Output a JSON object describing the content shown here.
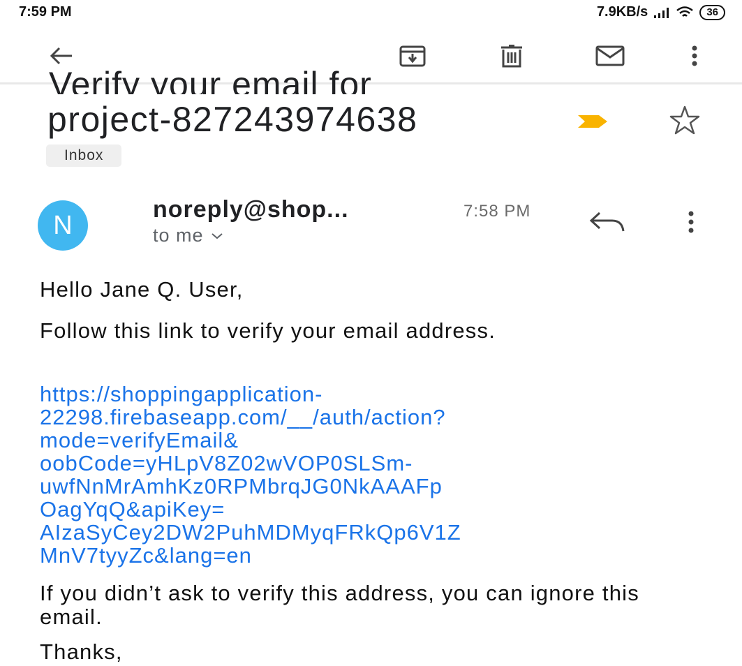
{
  "status_bar": {
    "time": "7:59 PM",
    "network_speed": "7.9KB/s",
    "battery": "36",
    "icons": [
      "signal-icon",
      "wifi-icon",
      "battery-icon"
    ]
  },
  "toolbar": {
    "icons": [
      "back-arrow-icon",
      "archive-icon",
      "delete-icon",
      "mark-unread-icon",
      "more-vert-icon"
    ]
  },
  "email": {
    "subject_line1": "Verify your email for",
    "subject_line2": "project-827243974638",
    "label": "Inbox",
    "sender_initial": "N",
    "sender_name": "noreply@shop...",
    "time": "7:58 PM",
    "recipient": "to me",
    "greeting": "Hello Jane Q. User,",
    "instruction": "Follow this link to verify your email address.",
    "link_lines": [
      "https://shoppingapplication-",
      "22298.firebaseapp.com/__/auth/action?",
      "mode=verifyEmail&",
      "oobCode=yHLpV8Z02wVOP0SLSm-",
      "uwfNnMrAmhKz0RPMbrqJG0NkAAAFp",
      "OagYqQ&apiKey=",
      "AIzaSyCey2DW2PuhMDMyqFRkQp6V1Z",
      "MnV7tyyZc&lang=en"
    ],
    "ignore_note": "If you didn’t ask to verify this address, you can ignore this email.",
    "signoff": "Thanks,"
  },
  "colors": {
    "avatar": "#41b7f0",
    "link": "#1a73e8",
    "important_marker": "#f9b300",
    "label_bg": "#efefef"
  }
}
